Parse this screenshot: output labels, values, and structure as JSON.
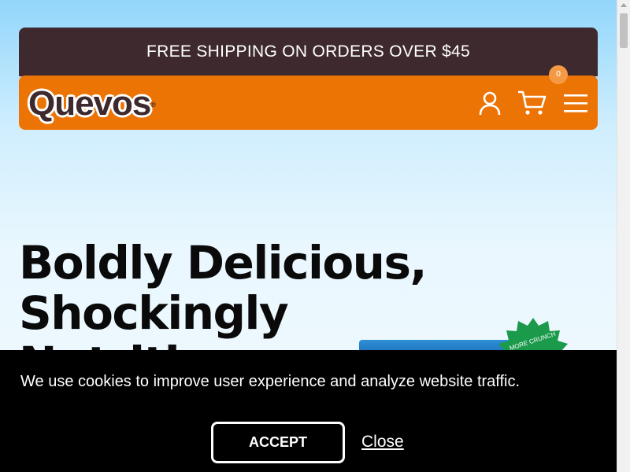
{
  "promo": {
    "text": "FREE SHIPPING ON ORDERS OVER $45"
  },
  "brand": {
    "logo_text": "Quevos",
    "registered_mark": "®"
  },
  "nav": {
    "icons": [
      "account-icon",
      "cart-icon",
      "menu-icon"
    ],
    "cart_count": "0"
  },
  "hero": {
    "title_line1": "Boldly Delicious,",
    "title_line2": "Shockingly",
    "title_line3": "Nutritious",
    "badge_text": "MORE CRUNCH"
  },
  "cookie": {
    "message": "We use cookies to improve user experience and analyze website traffic.",
    "accept_label": "ACCEPT",
    "close_label": "Close"
  },
  "colors": {
    "promo_bg": "#3e2a2e",
    "nav_bg": "#ec7405",
    "badge_green": "#1a9a4a",
    "cookie_bg": "#000000"
  }
}
